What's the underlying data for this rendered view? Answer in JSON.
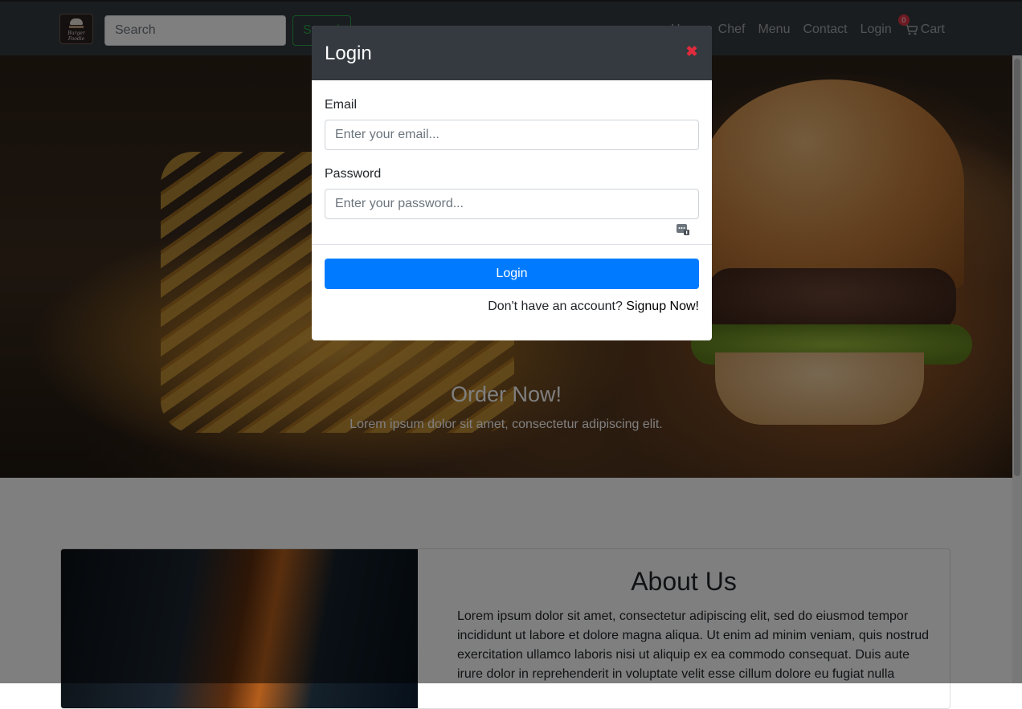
{
  "navbar": {
    "logo_text": "Burger Foodie",
    "search": {
      "placeholder": "Search",
      "button_label": "Search"
    },
    "links": [
      {
        "label": "Home"
      },
      {
        "label": "Chef"
      },
      {
        "label": "Menu"
      },
      {
        "label": "Contact"
      },
      {
        "label": "Login"
      }
    ],
    "cart": {
      "label": "Cart",
      "count": "0"
    }
  },
  "hero": {
    "title": "Order Now!",
    "subtitle": "Lorem ipsum dolor sit amet, consectetur adipiscing elit."
  },
  "about": {
    "title": "About Us",
    "text": "Lorem ipsum dolor sit amet, consectetur adipiscing elit, sed do eiusmod tempor incididunt ut labore et dolore magna aliqua. Ut enim ad minim veniam, quis nostrud exercitation ullamco laboris nisi ut aliquip ex ea commodo consequat. Duis aute irure dolor in reprehenderit in voluptate velit esse cillum dolore eu fugiat nulla"
  },
  "modal": {
    "title": "Login",
    "close_icon": "close-icon",
    "email": {
      "label": "Email",
      "placeholder": "Enter your email..."
    },
    "password": {
      "label": "Password",
      "placeholder": "Enter your password..."
    },
    "submit_label": "Login",
    "signup_prompt": "Don't have an account?",
    "signup_link": "Signup Now!"
  },
  "colors": {
    "navbar_bg": "#343a40",
    "primary": "#007bff",
    "success": "#28a745",
    "danger": "#dc3545"
  }
}
